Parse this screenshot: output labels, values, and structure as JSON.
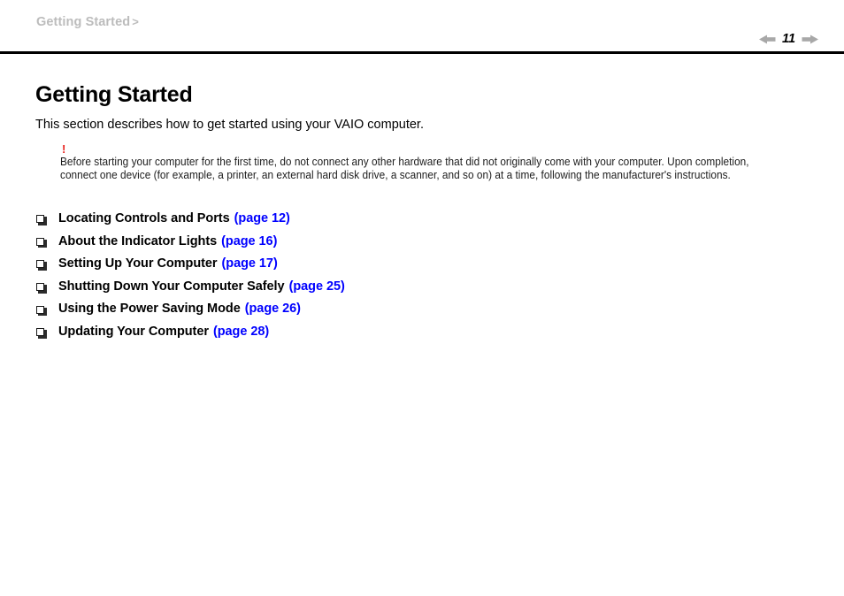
{
  "header": {
    "breadcrumb_label": "Getting Started",
    "breadcrumb_separator": ">",
    "page_number": "11",
    "prev_icon": "left-triangle-arrow-icon",
    "next_icon": "right-triangle-arrow-icon"
  },
  "main": {
    "title": "Getting Started",
    "intro": "This section describes how to get started using your VAIO computer.",
    "note": {
      "mark": "!",
      "text": "Before starting your computer for the first time, do not connect any other hardware that did not originally come with your computer. Upon completion, connect one device (for example, a printer, an external hard disk drive, a scanner, and so on) at a time, following the manufacturer's instructions."
    },
    "links": [
      {
        "title": "Locating Controls and Ports",
        "page_ref": "(page 12)"
      },
      {
        "title": "About the Indicator Lights",
        "page_ref": "(page 16)"
      },
      {
        "title": "Setting Up Your Computer",
        "page_ref": "(page 17)"
      },
      {
        "title": "Shutting Down Your Computer Safely",
        "page_ref": "(page 25)"
      },
      {
        "title": "Using the Power Saving Mode",
        "page_ref": "(page 26)"
      },
      {
        "title": "Updating Your Computer",
        "page_ref": "(page 28)"
      }
    ],
    "bullet_icon": "hollow-square-bullet-icon"
  },
  "colors": {
    "link_blue": "#0000ff",
    "note_red": "#e8231f",
    "breadcrumb_gray": "#bcbcbc",
    "arrow_gray": "#a8a8a8",
    "rule_black": "#000000"
  }
}
